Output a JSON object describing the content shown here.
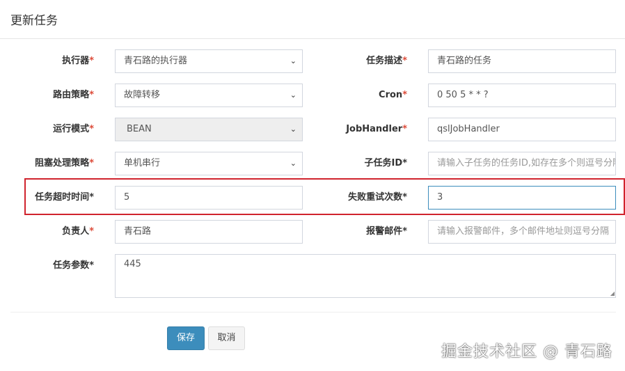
{
  "title": "更新任务",
  "fields": {
    "executor": {
      "label": "执行器",
      "value": "青石路的执行器"
    },
    "desc": {
      "label": "任务描述",
      "value": "青石路的任务"
    },
    "route": {
      "label": "路由策略",
      "value": "故障转移"
    },
    "cron": {
      "label": "Cron",
      "value": "0 50 5 * * ?"
    },
    "mode": {
      "label": "运行模式",
      "value": "BEAN"
    },
    "handler": {
      "label": "JobHandler",
      "value": "qslJobHandler"
    },
    "block": {
      "label": "阻塞处理策略",
      "value": "单机串行"
    },
    "child": {
      "label": "子任务ID",
      "placeholder": "请输入子任务的任务ID,如存在多个则逗号分隔"
    },
    "timeout": {
      "label": "任务超时时间",
      "value": "5"
    },
    "retry": {
      "label": "失败重试次数",
      "value": "3"
    },
    "author": {
      "label": "负责人",
      "value": "青石路"
    },
    "alarm": {
      "label": "报警邮件",
      "placeholder": "请输入报警邮件，多个邮件地址则逗号分隔"
    },
    "param": {
      "label": "任务参数",
      "value": "445"
    }
  },
  "required_mark": "*",
  "buttons": {
    "save": "保存",
    "cancel": "取消"
  },
  "watermark": "掘金技术社区 @ 青石路"
}
